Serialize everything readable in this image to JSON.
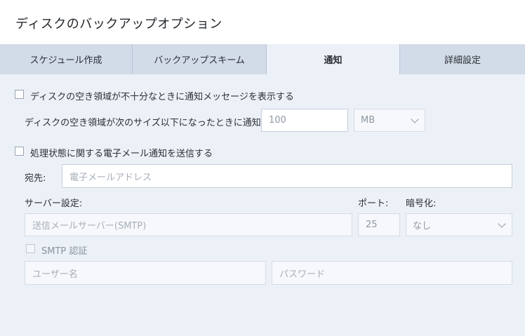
{
  "window": {
    "title": "ディスクのバックアップオプション"
  },
  "tabs": [
    {
      "label": "スケジュール作成",
      "active": false
    },
    {
      "label": "バックアップスキーム",
      "active": false
    },
    {
      "label": "通知",
      "active": true
    },
    {
      "label": "詳細設定",
      "active": false
    }
  ],
  "low_space": {
    "checkbox_label": "ディスクの空き領域が不十分なときに通知メッセージを表示する",
    "checked": false,
    "threshold_label": "ディスクの空き領域が次のサイズ以下になったときに通知する:",
    "threshold_value": "100",
    "unit": "MB"
  },
  "email": {
    "checkbox_label": "処理状態に関する電子メール通知を送信する",
    "checked": false,
    "to_label": "宛先:",
    "to_placeholder": "電子メールアドレス",
    "server_label": "サーバー設定:",
    "port_label": "ポート:",
    "encryption_label": "暗号化:",
    "server_placeholder": "送信メールサーバー(SMTP)",
    "port_value": "25",
    "encryption_value": "なし",
    "smtp_auth_label": "SMTP 認証",
    "smtp_auth_checked": false,
    "username_placeholder": "ユーザー名",
    "password_placeholder": "パスワード"
  },
  "colors": {
    "background": "#ecf1f8",
    "tab_inactive": "#d2dbe8",
    "titlebar": "#ffffff"
  }
}
